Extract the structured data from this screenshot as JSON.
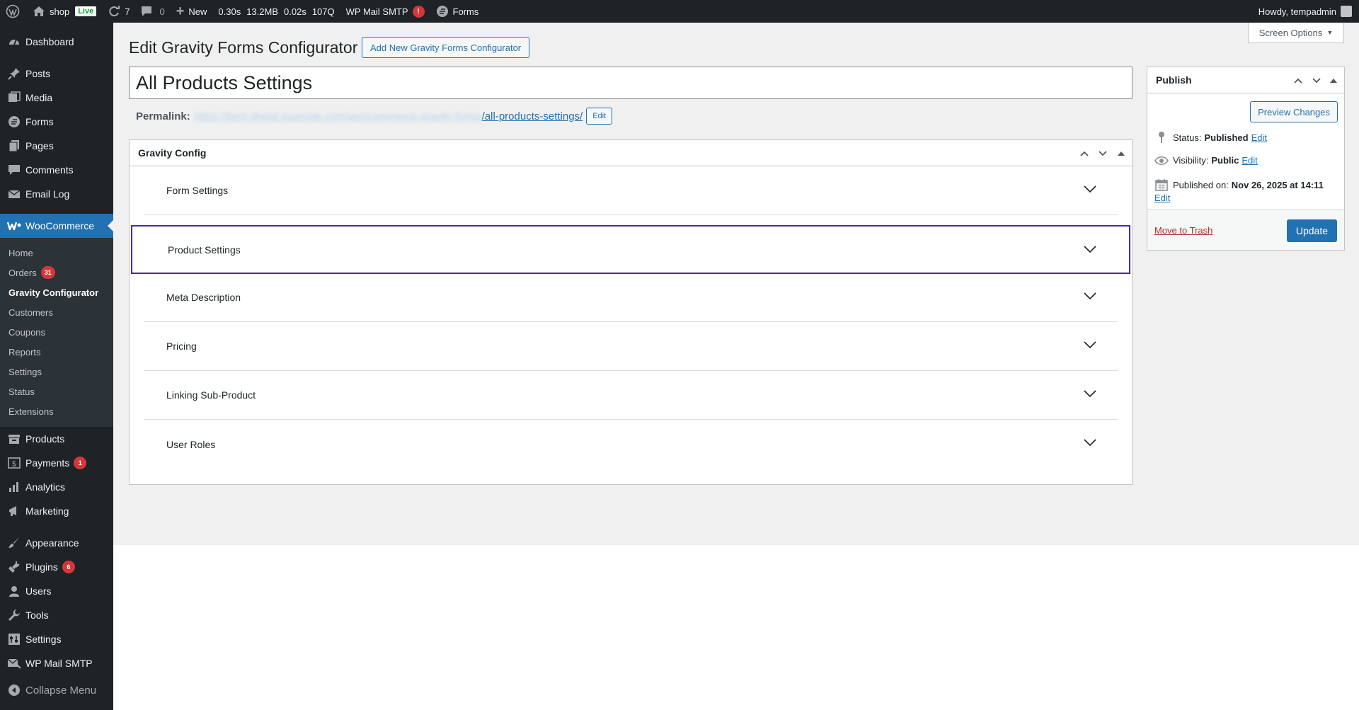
{
  "adminbar": {
    "site_name": "shop",
    "live_badge": "Live",
    "updates_count": "7",
    "comments_count": "0",
    "new_label": "New",
    "stats": [
      "0.30s",
      "13.2MB",
      "0.02s",
      "107Q"
    ],
    "smtp_label": "WP Mail SMTP",
    "smtp_alert": "!",
    "forms_label": "Forms",
    "howdy": "Howdy, tempadmin"
  },
  "sidebar": {
    "top_items": [
      {
        "label": "Dashboard",
        "icon": "dashboard-icon"
      },
      {
        "label": "Posts",
        "icon": "pin-icon"
      },
      {
        "label": "Media",
        "icon": "media-icon"
      },
      {
        "label": "Forms",
        "icon": "forms-icon"
      },
      {
        "label": "Pages",
        "icon": "pages-icon"
      },
      {
        "label": "Comments",
        "icon": "comment-icon"
      },
      {
        "label": "Email Log",
        "icon": "email-icon"
      }
    ],
    "woocommerce": {
      "label": "WooCommerce",
      "icon": "woo-icon"
    },
    "submenu": [
      {
        "label": "Home"
      },
      {
        "label": "Orders",
        "badge": "31"
      },
      {
        "label": "Gravity Configurator",
        "current": true
      },
      {
        "label": "Customers"
      },
      {
        "label": "Coupons"
      },
      {
        "label": "Reports"
      },
      {
        "label": "Settings"
      },
      {
        "label": "Status"
      },
      {
        "label": "Extensions"
      }
    ],
    "mid_items": [
      {
        "label": "Products",
        "icon": "archive-icon"
      },
      {
        "label": "Payments",
        "icon": "dollar-icon",
        "badge": "1"
      },
      {
        "label": "Analytics",
        "icon": "chart-bar-icon"
      },
      {
        "label": "Marketing",
        "icon": "megaphone-icon"
      }
    ],
    "bottom_items": [
      {
        "label": "Appearance",
        "icon": "brush-icon"
      },
      {
        "label": "Plugins",
        "icon": "plugin-icon",
        "badge": "6"
      },
      {
        "label": "Users",
        "icon": "user-icon"
      },
      {
        "label": "Tools",
        "icon": "wrench-icon"
      },
      {
        "label": "Settings",
        "icon": "settings-icon"
      },
      {
        "label": "WP Mail SMTP",
        "icon": "mail-smtp-icon"
      }
    ],
    "collapse_label": "Collapse Menu"
  },
  "screen_options": "Screen Options",
  "page": {
    "title": "Edit Gravity Forms Configurator",
    "add_new_label": "Add New Gravity Forms Configurator",
    "post_title": "All Products Settings",
    "permalink_label": "Permalink:",
    "permalink_base": "https://farm-digital.example.com/woocommerce-gravity-forms",
    "permalink_slug": "/all-products-settings/",
    "permalink_edit": "Edit"
  },
  "metabox": {
    "title": "Gravity Config",
    "sections": [
      {
        "label": "Form Settings"
      },
      {
        "label": "Product Settings"
      },
      {
        "label": "Meta Description"
      },
      {
        "label": "Pricing"
      },
      {
        "label": "Linking Sub-Product"
      },
      {
        "label": "User Roles"
      }
    ]
  },
  "publish": {
    "title": "Publish",
    "preview_label": "Preview Changes",
    "status_label": "Status:",
    "status_value": "Published",
    "visibility_label": "Visibility:",
    "visibility_value": "Public",
    "published_label": "Published on:",
    "published_value": "Nov 26, 2025 at 14:11",
    "edit_label": "Edit",
    "trash_label": "Move to Trash",
    "update_label": "Update"
  },
  "colors": {
    "accent": "#2271b1",
    "focus_outline": "#4b2c92",
    "badge": "#d63638"
  }
}
